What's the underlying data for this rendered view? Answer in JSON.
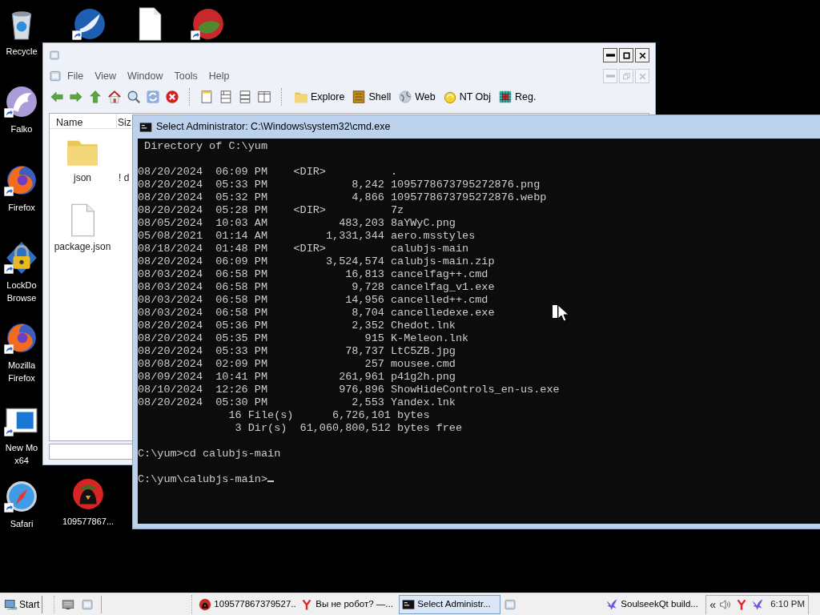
{
  "desktop_icons": [
    {
      "kind": "bin",
      "shortcut": false,
      "label_lines": [
        "Recycle"
      ]
    },
    {
      "kind": "bird-globe",
      "shortcut": true
    },
    {
      "kind": "page",
      "shortcut": false
    },
    {
      "kind": "red-round",
      "shortcut": true
    },
    {
      "kind": "eagle",
      "shortcut": true,
      "label_lines": [
        "Falko"
      ]
    },
    {
      "kind": "fox-globe",
      "shortcut": true,
      "label_lines": [
        "Firefox"
      ]
    },
    {
      "kind": "lock",
      "shortcut": true,
      "label_lines": [
        "LockDo",
        "Browse"
      ]
    },
    {
      "kind": "fox-globe",
      "shortcut": true,
      "label_lines": [
        "Mozilla",
        "Firefox"
      ]
    },
    {
      "kind": "window-app",
      "shortcut": true,
      "label_lines": [
        "New Mo",
        "x64"
      ]
    },
    {
      "kind": "compass",
      "shortcut": true,
      "label_lines": [
        "Safari"
      ]
    },
    {
      "kind": "red-bird",
      "shortcut": false,
      "label_lines": [
        "109577867..."
      ]
    }
  ],
  "explorer": {
    "window_buttons": [
      {
        "kind": "minimize",
        "disabled": false
      },
      {
        "kind": "maximize",
        "disabled": false
      },
      {
        "kind": "close",
        "disabled": false
      }
    ],
    "menu": [
      "File",
      "View",
      "Window",
      "Tools",
      "Help"
    ],
    "child_window_buttons": [
      {
        "kind": "minimize",
        "disabled": true
      },
      {
        "kind": "restore",
        "disabled": true
      },
      {
        "kind": "close",
        "disabled": true
      }
    ],
    "toolbar": [
      {
        "kind": "back"
      },
      {
        "kind": "forward"
      },
      {
        "kind": "up"
      },
      {
        "kind": "home"
      },
      {
        "kind": "search"
      },
      {
        "kind": "refresh"
      },
      {
        "kind": "stop"
      },
      {
        "kind": "separator"
      },
      {
        "kind": "pane1"
      },
      {
        "kind": "pane2"
      },
      {
        "kind": "pane3"
      },
      {
        "kind": "pane4"
      },
      {
        "kind": "separator"
      },
      {
        "kind": "folder",
        "label": "Explore"
      },
      {
        "kind": "shell",
        "label": "Shell"
      },
      {
        "kind": "globe",
        "label": "Web"
      },
      {
        "kind": "ntobj",
        "label": "NT Obj"
      },
      {
        "kind": "registry",
        "label": "Reg."
      }
    ],
    "columns": [
      "Name",
      "Siz"
    ],
    "items": [
      {
        "kind": "folder",
        "label": "json"
      },
      {
        "kind": "cut",
        "label": "! d"
      },
      {
        "kind": "file",
        "label": "package.json"
      }
    ]
  },
  "console": {
    "title": "Select Administrator: C:\\Windows\\system32\\cmd.exe",
    "blocks": [
      [
        " Directory of C:\\yum"
      ],
      [
        "08/20/2024  06:09 PM    <DIR>          .",
        "08/20/2024  05:33 PM             8,242 1095778673795272876.png",
        "08/20/2024  05:32 PM             4,866 1095778673795272876.webp",
        "08/20/2024  05:28 PM    <DIR>          7z",
        "08/05/2024  10:03 AM           483,203 8aYWyC.png",
        "05/08/2021  01:14 AM         1,331,344 aero.msstyles",
        "08/18/2024  01:48 PM    <DIR>          calubjs-main",
        "08/20/2024  06:09 PM         3,524,574 calubjs-main.zip",
        "08/03/2024  06:58 PM            16,813 cancelfag++.cmd",
        "08/03/2024  06:58 PM             9,728 cancelfag_v1.exe",
        "08/03/2024  06:58 PM            14,956 cancelled++.cmd",
        "08/03/2024  06:58 PM             8,704 cancelledexe.exe",
        "08/20/2024  05:36 PM             2,352 Chedot.lnk",
        "08/20/2024  05:35 PM               915 K-Meleon.lnk",
        "08/20/2024  05:33 PM            78,737 LtC5ZB.jpg",
        "08/08/2024  02:09 PM               257 mousee.cmd",
        "08/09/2024  10:41 PM           261,961 p41g2h.png",
        "08/10/2024  12:26 PM           976,896 ShowHideControls_en-us.exe",
        "08/20/2024  05:30 PM             2,553 Yandex.lnk",
        "              16 File(s)      6,726,101 bytes",
        "               3 Dir(s)  61,060,800,512 bytes free"
      ],
      [
        "C:\\yum>cd calubjs-main"
      ],
      [
        "C:\\yum\\calubjs-main>"
      ]
    ],
    "cursor": true
  },
  "taskbar": {
    "start": "Start",
    "quick_launch": [
      {
        "kind": "desktop"
      },
      {
        "kind": "window"
      }
    ],
    "tasks": [
      {
        "kind": "red-bird",
        "label": "109577867379527...",
        "selected": false
      },
      {
        "kind": "y-logo",
        "label": "Вы не робот? —...",
        "selected": false
      },
      {
        "kind": "console",
        "label": "Select Administr...",
        "selected": true
      },
      {
        "kind": "window",
        "selected": false
      },
      {
        "kind": "purple-bird",
        "label": "SoulseekQt build...",
        "selected": false
      }
    ],
    "tray": {
      "chevron": "«",
      "icons": [
        {
          "kind": "speaker"
        },
        {
          "kind": "y-logo"
        },
        {
          "kind": "purple-bird"
        }
      ],
      "clock": "6:10 PM"
    }
  }
}
